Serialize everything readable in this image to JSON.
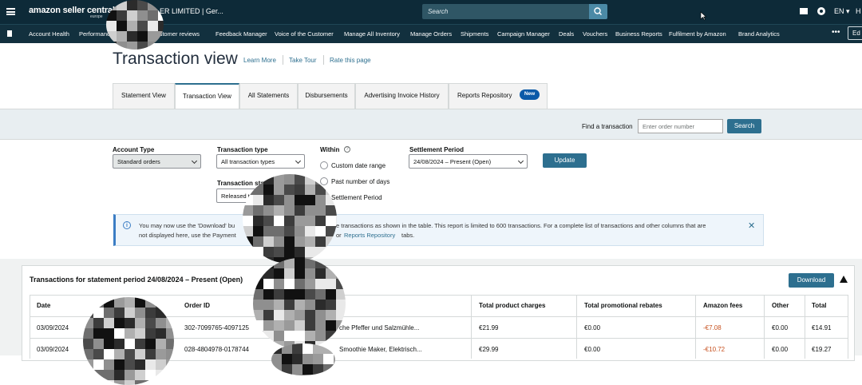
{
  "topbar": {
    "brand": "amazon seller central",
    "brand_sub": "europe",
    "account_name": "ER LIMITED | Ger...",
    "search_placeholder": "Search",
    "language": "EN ▾",
    "help_initial": "H"
  },
  "nav": {
    "items": [
      "Account Health",
      "Performance",
      "Customer reviews",
      "Feedback Manager",
      "Voice of the Customer",
      "Manage All Inventory",
      "Manage Orders",
      "Shipments",
      "Campaign Manager",
      "Deals",
      "Vouchers",
      "Business Reports",
      "Fulfilment by Amazon",
      "Brand Analytics"
    ],
    "more": "•••",
    "edit": "Ed"
  },
  "header": {
    "title": "Transaction view",
    "links": [
      "Learn More",
      "Take Tour",
      "Rate this page"
    ]
  },
  "tabs": [
    {
      "label": "Statement View",
      "active": false
    },
    {
      "label": "Transaction View",
      "active": true
    },
    {
      "label": "All Statements",
      "active": false
    },
    {
      "label": "Disbursements",
      "active": false
    },
    {
      "label": "Advertising Invoice History",
      "active": false
    },
    {
      "label": "Reports Repository",
      "active": false,
      "badge": "New"
    }
  ],
  "find": {
    "label": "Find a transaction",
    "placeholder": "Enter order number",
    "button": "Search"
  },
  "filters": {
    "account_type_label": "Account Type",
    "account_type_value": "Standard orders",
    "transaction_type_label": "Transaction type",
    "transaction_type_value": "All transaction types",
    "transaction_status_label": "Transaction sta",
    "transaction_status_value": "Released t",
    "within_label": "Within",
    "within_options": [
      "Custom date range",
      "Past number of days",
      "Settlement Period"
    ],
    "settlement_label": "Settlement Period",
    "settlement_value": "24/08/2024 – Present (Open)",
    "update_button": "Update"
  },
  "alert": {
    "line1_a": "You may now use the 'Download' bu",
    "line1_b": "e transactions as shown in the table. This report is limited to 600 transactions. For a complete list of transactions and other columns that are",
    "line2_a": "not displayed here, use the Payment",
    "line2_b": "or",
    "line2_link": "Reports Repository",
    "line2_c": "tabs."
  },
  "table": {
    "title": "Transactions for statement period 24/08/2024 – Present (Open)",
    "download": "Download",
    "columns": [
      "Date",
      "Order ID",
      "Total product charges",
      "Total promotional rebates",
      "Amazon fees",
      "Other",
      "Total"
    ],
    "rows": [
      {
        "date": "03/09/2024",
        "order_id": "302-7099765-4097125",
        "product": "che Pfeffer und Salzmühle...",
        "charges": "€21.99",
        "rebates": "€0.00",
        "fees": "-€7.08",
        "other": "€0.00",
        "total": "€14.91"
      },
      {
        "date": "03/09/2024",
        "order_id": "028-4804978-0178744",
        "product": "Smoothie Maker, Elektrisch...",
        "charges": "€29.99",
        "rebates": "€0.00",
        "fees": "-€10.72",
        "other": "€0.00",
        "total": "€19.27"
      }
    ]
  },
  "colors": {
    "topbar": "#0d2a38",
    "accent": "#2d6f8f",
    "negative": "#c7511f"
  }
}
